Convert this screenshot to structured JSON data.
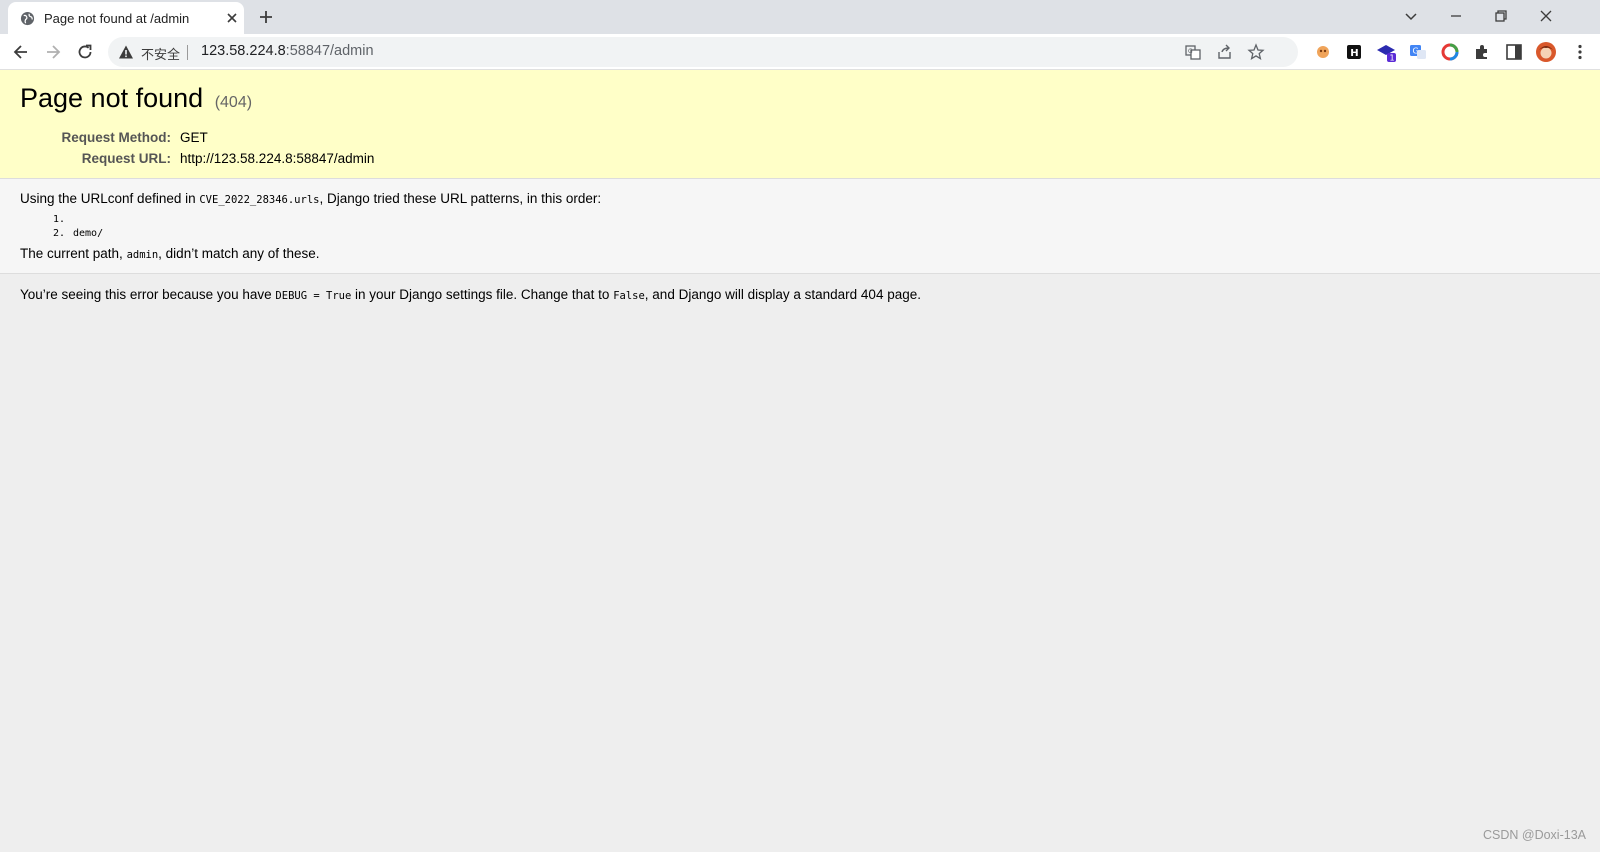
{
  "browser": {
    "tab_title": "Page not found at /admin",
    "security_label": "不安全",
    "url_host": "123.58.224.8",
    "url_rest": ":58847/admin",
    "extension_badge": "1"
  },
  "page": {
    "title": "Page not found",
    "status_code": "(404)",
    "request_method_label": "Request Method:",
    "request_method": "GET",
    "request_url_label": "Request URL:",
    "request_url": "http://123.58.224.8:58847/admin",
    "urlconf_intro": "Using the URLconf defined in ",
    "urlconf_module": "CVE_2022_28346.urls",
    "urlconf_outro": ", Django tried these URL patterns, in this order:",
    "patterns": [
      {
        "num": "1.",
        "pattern": ""
      },
      {
        "num": "2.",
        "pattern": "demo/"
      }
    ],
    "current_path_intro": "The current path, ",
    "current_path": "admin",
    "current_path_outro": ", didn’t match any of these.",
    "explain_1": "You’re seeing this error because you have ",
    "explain_debug": "DEBUG = True",
    "explain_2": " in your Django settings file. Change that to ",
    "explain_false": "False",
    "explain_3": ", and Django will display a standard 404 page."
  },
  "watermark": "CSDN @Doxi-13A",
  "colors": {
    "summary_bg": "#ffffc8",
    "info_bg": "#f6f6f6",
    "page_bg": "#eeeeee",
    "tabstrip_bg": "#dee1e6"
  }
}
